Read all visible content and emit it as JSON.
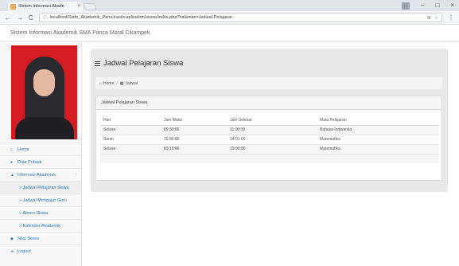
{
  "browser": {
    "tab_title": "Sistem Informasi Akade",
    "url": "localhost/Sisfo_Akademik_Pamci/sisfo-aplication/siswa/index.php?halaman=Jadwal-Pelajaran"
  },
  "app": {
    "title": "Sistem Informasi Akademik SMA Panca Moral Cikampek"
  },
  "sidebar": {
    "items": [
      {
        "label": "Home",
        "icon": "home-icon"
      },
      {
        "label": "Data Pribadi",
        "icon": "user-icon"
      },
      {
        "label": "Informasi Akademik",
        "icon": "info-icon"
      },
      {
        "label": "» Jadwal Pelajaran Siswa",
        "icon": ""
      },
      {
        "label": "» Jadwal Mengajar Guru",
        "icon": ""
      },
      {
        "label": "» Absen Siswa",
        "icon": ""
      },
      {
        "label": "» Kalender Akademik",
        "icon": ""
      },
      {
        "label": "Nilai Siswa",
        "icon": "grade-icon"
      },
      {
        "label": "Logout",
        "icon": "logout-icon"
      }
    ]
  },
  "main": {
    "page_title": "Jadwal Pelajaran Siswa",
    "breadcrumb": {
      "home": "Home",
      "current": "Jadwal"
    },
    "box_title": "Jadwal Pelajaran Siswa",
    "table": {
      "headers": [
        "Hari",
        "Jam Mulai",
        "Jam Selesai",
        "Mata Pelajaran"
      ],
      "rows": [
        [
          "Selasa",
          "09:30:00",
          "11:00:00",
          "Bahasa Indonesia"
        ],
        [
          "Senin",
          "15:39:00",
          "14:01:00",
          "Matematika"
        ],
        [
          "Selasa",
          "03:18:00",
          "19:00:00",
          "Matematika"
        ]
      ]
    }
  }
}
